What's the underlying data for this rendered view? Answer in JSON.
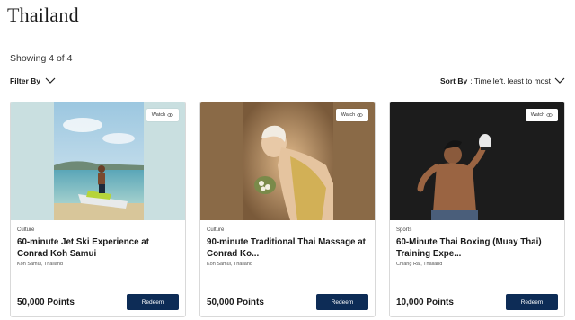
{
  "page": {
    "title": "Thailand",
    "showing": "Showing 4 of 4"
  },
  "controls": {
    "filter_label": "Filter By",
    "sort_label": "Sort By",
    "sort_value": ": Time left, least to most"
  },
  "cards": [
    {
      "watch": "Watch",
      "category": "Culture",
      "title": "60-minute Jet Ski Experience at Conrad Koh Samui",
      "location": "Koh Samui, Thailand",
      "points": "50,000 Points",
      "cta": "Redeem"
    },
    {
      "watch": "Watch",
      "category": "Culture",
      "title": "90-minute Traditional Thai Massage at Conrad Ko...",
      "location": "Koh Samui, Thailand",
      "points": "50,000 Points",
      "cta": "Redeem"
    },
    {
      "watch": "Watch",
      "category": "Sports",
      "title": "60-Minute Thai Boxing (Muay Thai) Training Expe...",
      "location": "Chiang Rai, Thailand",
      "points": "10,000 Points",
      "cta": "Redeem"
    }
  ],
  "colors": {
    "accent": "#0d2c56",
    "card1_bg": "#c9dfe0",
    "card2_bg": "#8a6a47",
    "card3_bg": "#1b1b1b"
  }
}
